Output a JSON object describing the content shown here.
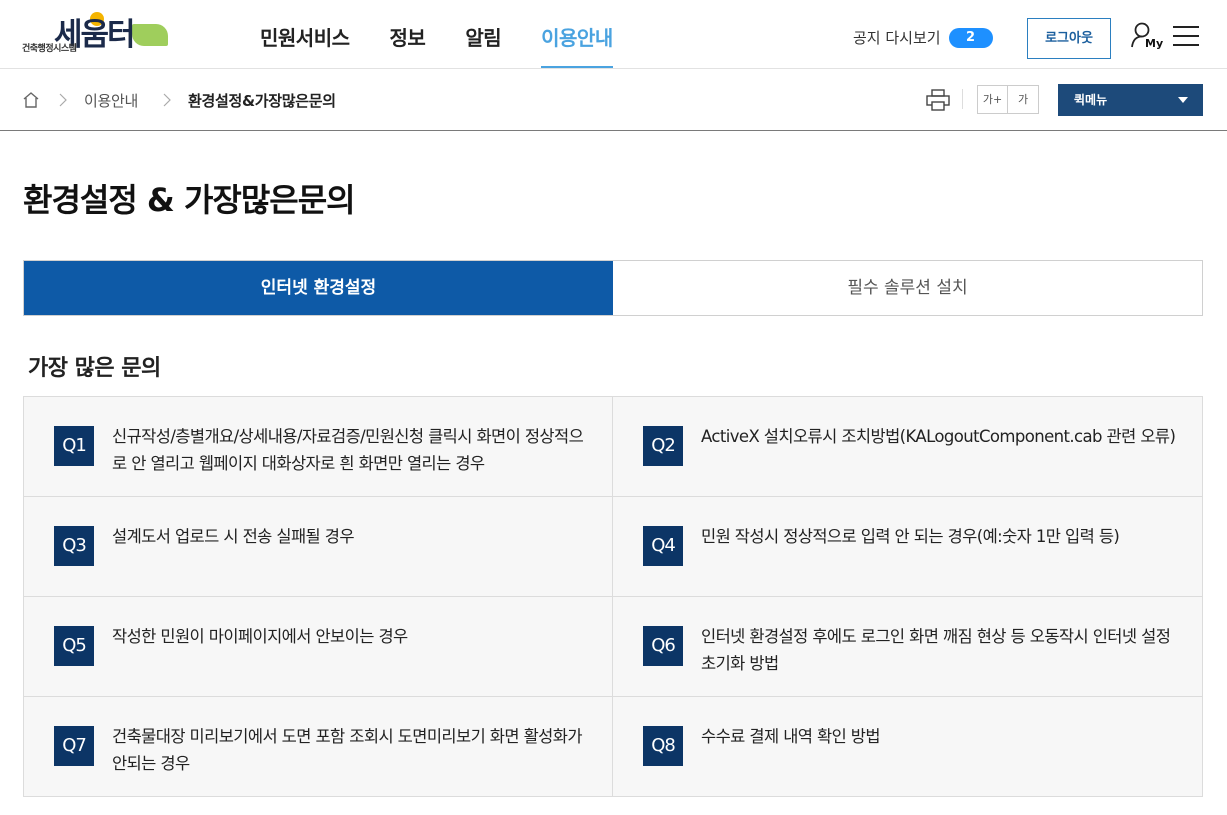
{
  "header": {
    "logo_sub": "건축행정시스템",
    "logo_main": "세움터",
    "nav": [
      "민원서비스",
      "정보",
      "알림",
      "이용안내"
    ],
    "notice_replay_label": "공지 다시보기",
    "notice_count": "2",
    "logout_label": "로그아웃",
    "my_label": "My"
  },
  "breadcrumb": {
    "items": [
      "이용안내",
      "환경설정&가장많은문의"
    ]
  },
  "toolbar": {
    "font_up": "가+",
    "font_down": "가",
    "quick_menu": "퀵메뉴"
  },
  "page": {
    "title": "환경설정 & 가장많은문의",
    "tabs": [
      "인터넷 환경설정",
      "필수 솔루션 설치"
    ],
    "section_title": "가장 많은 문의"
  },
  "faq": [
    {
      "q": "Q1",
      "text": "신규작성/층별개요/상세내용/자료검증/민원신청 클릭시 화면이 정상적으로 안 열리고 웹페이지 대화상자로 흰 화면만 열리는 경우"
    },
    {
      "q": "Q2",
      "text": "ActiveX 설치오류시 조치방법(KALogoutComponent.cab 관련 오류)"
    },
    {
      "q": "Q3",
      "text": "설계도서 업로드 시 전송 실패될 경우"
    },
    {
      "q": "Q4",
      "text": "민원 작성시 정상적으로 입력 안 되는 경우(예:숫자 1만 입력 등)"
    },
    {
      "q": "Q5",
      "text": "작성한 민원이 마이페이지에서 안보이는 경우"
    },
    {
      "q": "Q6",
      "text": "인터넷 환경설정 후에도 로그인 화면 깨짐 현상 등 오동작시 인터넷 설정 초기화 방법"
    },
    {
      "q": "Q7",
      "text": "건축물대장 미리보기에서 도면 포함 조회시 도면미리보기 화면 활성화가 안되는 경우"
    },
    {
      "q": "Q8",
      "text": "수수료 결제 내역 확인 방법"
    }
  ],
  "colors": {
    "primary": "#0e5aa7",
    "badge": "#0c3566",
    "active_nav": "#4aa3e0",
    "quick_menu": "#1d4a7a"
  }
}
